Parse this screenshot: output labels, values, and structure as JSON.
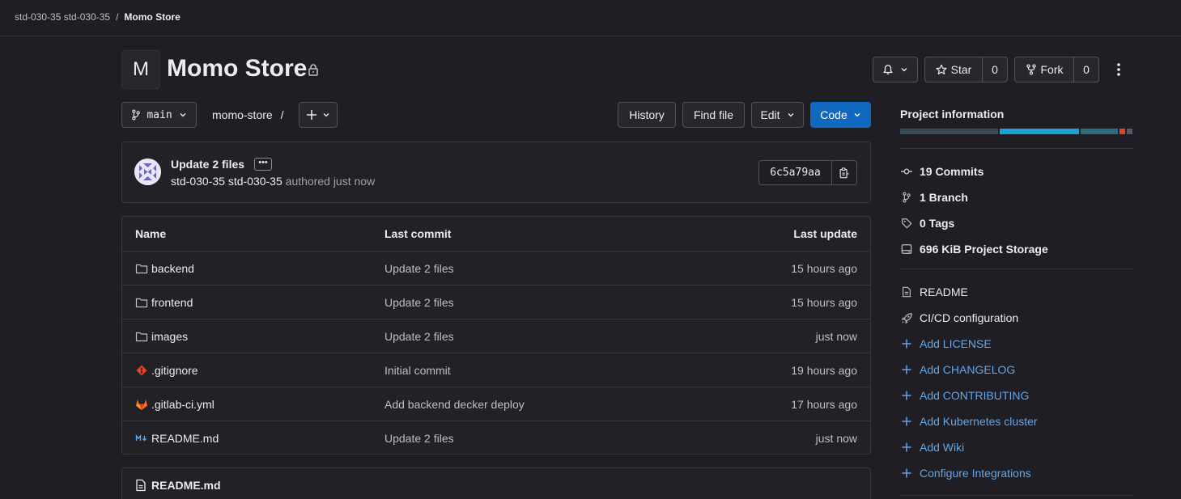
{
  "breadcrumb": {
    "group": "std-030-35 std-030-35",
    "separator": "/",
    "project": "Momo Store"
  },
  "project": {
    "avatar_letter": "M",
    "title": "Momo Store",
    "visibility_icon": "lock-icon"
  },
  "actions": {
    "star_label": "Star",
    "star_count": "0",
    "fork_label": "Fork",
    "fork_count": "0"
  },
  "repo_bar": {
    "branch": "main",
    "path": "momo-store",
    "path_sep": "/",
    "history": "History",
    "find_file": "Find file",
    "edit": "Edit",
    "code": "Code"
  },
  "commit": {
    "title": "Update 2 files",
    "ellipsis": "•••",
    "author": "std-030-35 std-030-35",
    "authored": "authored just now",
    "sha": "6c5a79aa"
  },
  "file_table": {
    "headers": {
      "name": "Name",
      "last_commit": "Last commit",
      "last_update": "Last update"
    },
    "rows": [
      {
        "name": "backend",
        "icon": "folder-icon",
        "commit": "Update 2 files",
        "updated": "15 hours ago"
      },
      {
        "name": "frontend",
        "icon": "folder-icon",
        "commit": "Update 2 files",
        "updated": "15 hours ago"
      },
      {
        "name": "images",
        "icon": "folder-icon",
        "commit": "Update 2 files",
        "updated": "just now"
      },
      {
        "name": ".gitignore",
        "icon": "git-icon",
        "commit": "Initial commit",
        "updated": "19 hours ago"
      },
      {
        "name": ".gitlab-ci.yml",
        "icon": "gitlab-icon",
        "commit": "Add backend decker deploy",
        "updated": "17 hours ago"
      },
      {
        "name": "README.md",
        "icon": "markdown-icon",
        "commit": "Update 2 files",
        "updated": "just now"
      }
    ]
  },
  "readme": {
    "title": "README.md"
  },
  "sidebar": {
    "heading": "Project information",
    "stats": [
      {
        "icon": "commit-icon",
        "label": "19 Commits"
      },
      {
        "icon": "branch-icon",
        "label": "1 Branch"
      },
      {
        "icon": "tag-icon",
        "label": "0 Tags"
      },
      {
        "icon": "storage-icon",
        "label": "696 KiB Project Storage"
      }
    ],
    "links": [
      {
        "icon": "document-icon",
        "label": "README"
      },
      {
        "icon": "rocket-icon",
        "label": "CI/CD configuration"
      },
      {
        "icon": "plus-icon",
        "label": "Add LICENSE"
      },
      {
        "icon": "plus-icon",
        "label": "Add CHANGELOG"
      },
      {
        "icon": "plus-icon",
        "label": "Add CONTRIBUTING"
      },
      {
        "icon": "plus-icon",
        "label": "Add Kubernetes cluster"
      },
      {
        "icon": "plus-icon",
        "label": "Add Wiki"
      },
      {
        "icon": "plus-icon",
        "label": "Configure Integrations"
      }
    ],
    "language_bar_colors": [
      "#3a4a58",
      "#1aa2d4",
      "#2b6b7c",
      "#e24329",
      "#5a5a66"
    ]
  },
  "colors": {
    "background": "#1f1e24",
    "primary_button": "#1068bf",
    "link": "#63a6e9"
  }
}
